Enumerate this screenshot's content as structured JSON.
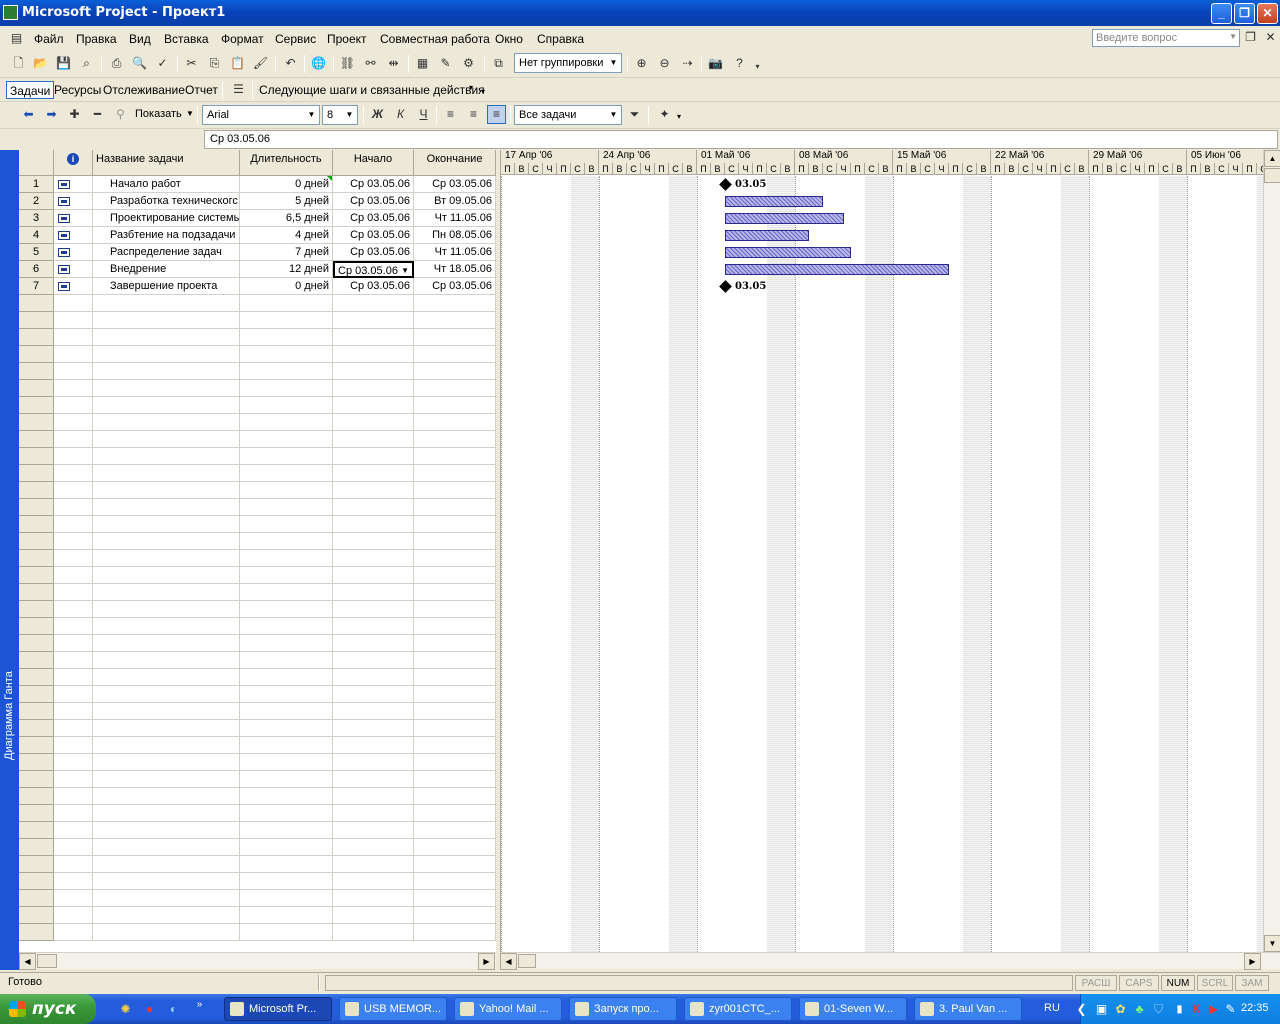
{
  "window": {
    "title": "Microsoft Project - Проект1",
    "buttons": {
      "minimize": "_",
      "restore": "❐",
      "close": "✕"
    }
  },
  "menubar": {
    "items": [
      "Файл",
      "Правка",
      "Вид",
      "Вставка",
      "Формат",
      "Сервис",
      "Проект",
      "Совместная работа",
      "Окно",
      "Справка"
    ],
    "help_placeholder": "Введите вопрос"
  },
  "toolbar_standard": {
    "grouping_value": "Нет группировки"
  },
  "toolbar_guide": {
    "tabs": [
      "Задачи",
      "Ресурсы",
      "Отслеживание",
      "Отчет"
    ],
    "next_steps": "Следующие шаги и связанные действия"
  },
  "toolbar_format": {
    "show_label": "Показать",
    "font": "Arial",
    "font_size": "8",
    "bold": "Ж",
    "italic": "К",
    "underline": "Ч",
    "filter": "Все задачи"
  },
  "formula_bar": {
    "value": "Ср 03.05.06"
  },
  "view_bar": {
    "label": "Диаграмма Ганта"
  },
  "table": {
    "columns": {
      "info": "i",
      "name": "Название задачи",
      "duration": "Длительность",
      "start": "Начало",
      "finish": "Окончание"
    },
    "rows": [
      {
        "id": "1",
        "name": "Начало работ",
        "duration": "0 дней",
        "start": "Ср 03.05.06",
        "finish": "Ср 03.05.06"
      },
      {
        "id": "2",
        "name": "Разработка техническогс",
        "duration": "5 дней",
        "start": "Ср 03.05.06",
        "finish": "Вт 09.05.06"
      },
      {
        "id": "3",
        "name": "Проектирование системы",
        "duration": "6,5 дней",
        "start": "Ср 03.05.06",
        "finish": "Чт 11.05.06"
      },
      {
        "id": "4",
        "name": "Разбтение на подзадачи",
        "duration": "4 дней",
        "start": "Ср 03.05.06",
        "finish": "Пн 08.05.06"
      },
      {
        "id": "5",
        "name": "Распределение задач",
        "duration": "7 дней",
        "start": "Ср 03.05.06",
        "finish": "Чт 11.05.06"
      },
      {
        "id": "6",
        "name": "Внедрение",
        "duration": "12 дней",
        "start": "Ср 03.05.06",
        "finish": "Чт 18.05.06"
      },
      {
        "id": "7",
        "name": "Завершение проекта",
        "duration": "0 дней",
        "start": "Ср 03.05.06",
        "finish": "Ср 03.05.06"
      }
    ]
  },
  "gantt": {
    "weeks": [
      "17 Апр '06",
      "24 Апр '06",
      "01 Май '06",
      "08 Май '06",
      "15 Май '06",
      "22 Май '06",
      "29 Май '06",
      "05 Июн '06"
    ],
    "day_letters": [
      "П",
      "В",
      "С",
      "Ч",
      "П",
      "С",
      "В"
    ],
    "timeline_start": "2006-04-17",
    "milestone_labels": [
      "03.05",
      "03.05"
    ],
    "tasks": [
      {
        "row": 1,
        "type": "milestone",
        "start": "2006-05-03",
        "days": 0
      },
      {
        "row": 2,
        "type": "bar",
        "start": "2006-05-03",
        "days": 7
      },
      {
        "row": 3,
        "type": "bar",
        "start": "2006-05-03",
        "days": 8.5
      },
      {
        "row": 4,
        "type": "bar",
        "start": "2006-05-03",
        "days": 6
      },
      {
        "row": 5,
        "type": "bar",
        "start": "2006-05-03",
        "days": 9
      },
      {
        "row": 6,
        "type": "bar",
        "start": "2006-05-03",
        "days": 16
      },
      {
        "row": 7,
        "type": "milestone",
        "start": "2006-05-03",
        "days": 0
      }
    ]
  },
  "status": {
    "text": "Готово",
    "indicators": [
      {
        "label": "РАСШ",
        "on": false
      },
      {
        "label": "CAPS",
        "on": false
      },
      {
        "label": "NUM",
        "on": true
      },
      {
        "label": "SCRL",
        "on": false
      },
      {
        "label": "ЗАМ",
        "on": false
      }
    ]
  },
  "taskbar": {
    "start": "пуск",
    "buttons": [
      "Microsoft Pr...",
      "USB MEMOR...",
      "Yahoo! Mail ...",
      "Запуск про...",
      "zyr001CTC_...",
      "01-Seven W...",
      "3. Paul Van ..."
    ],
    "active_index": 0,
    "lang": "RU",
    "clock": "22:35"
  }
}
